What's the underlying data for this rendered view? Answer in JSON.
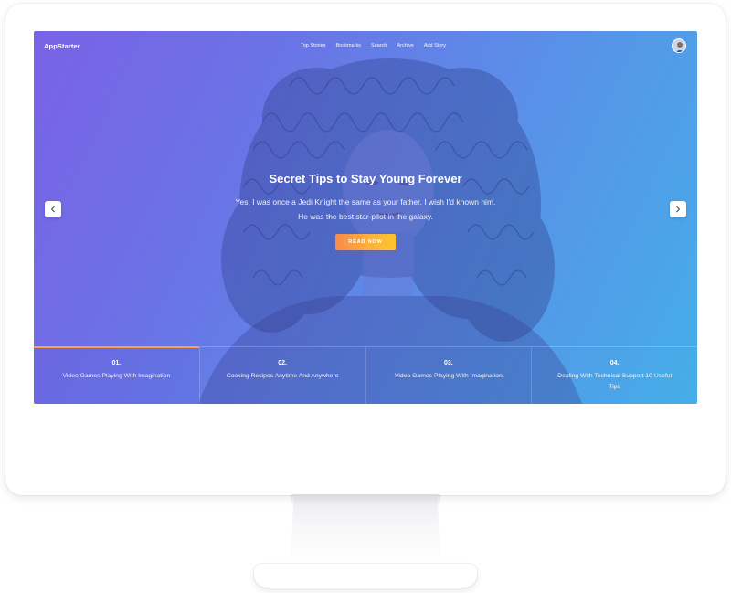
{
  "nav": {
    "brand": "AppStarter",
    "links": [
      "Top Stories",
      "Bookmarks",
      "Search",
      "Archive",
      "Add Story"
    ]
  },
  "hero": {
    "title_bold": "Secret Tips",
    "title_rest": " to Stay Young Forever",
    "description_line1": "Yes, I was once a Jedi Knight the same as your father. I wish I'd known him.",
    "description_line2": "He was the best star-pilot in the galaxy.",
    "cta_label": "READ NOW"
  },
  "tabs": [
    {
      "number": "01.",
      "title": "Video Games Playing With Imagination",
      "active": true
    },
    {
      "number": "02.",
      "title": "Cooking Recipes Anytime And Anywhere",
      "active": false
    },
    {
      "number": "03.",
      "title": "Video Games Playing With Imagination",
      "active": false
    },
    {
      "number": "04.",
      "title": "Dealing With Technical Support 10 Useful Tips",
      "active": false
    }
  ],
  "icons": {
    "prev": "chevron-left-icon",
    "next": "chevron-right-icon",
    "avatar": "user-avatar"
  },
  "colors": {
    "gradient_start": "#7a62e6",
    "gradient_end": "#45aee8",
    "cta_start": "#f98a49",
    "cta_end": "#fcc42c",
    "active_tab_indicator": "#f9a049"
  }
}
